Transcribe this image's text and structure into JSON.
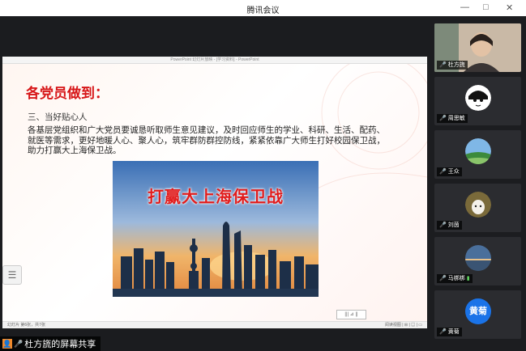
{
  "window": {
    "title": "腾讯会议",
    "controls": [
      "—",
      "□",
      "✕"
    ]
  },
  "presentation": {
    "app_title": "PowerPoint 幻灯片放映 - [学习资料] - PowerPoint",
    "heading": "各党员做到：",
    "subheading": "三、当好贴心人",
    "body": "各基层党组织和广大党员要诚恳听取师生意见建议，及时回应师生的学业、科研、生活、配药、就医等需求，更好地暖人心、聚人心，筑牢群防群控防线，紧紧依靠广大师生打好校园保卫战，助力打赢大上海保卫战。",
    "banner_text": "打赢大上海保卫战",
    "status_left": "幻灯片 第6张，共7张",
    "status_right": "阅读视图 | ⊞ | ▤ | ▭",
    "thumb_label": "|||  ⊿  ||"
  },
  "share": {
    "label": "杜方旒的屏幕共享"
  },
  "participants": [
    {
      "name": "杜方旒",
      "type": "video",
      "colors": [
        "#b48a6a",
        "#ddd"
      ]
    },
    {
      "name": "周思敏",
      "type": "avatar-cartoon"
    },
    {
      "name": "王众",
      "type": "avatar-landscape"
    },
    {
      "name": "刘茵",
      "type": "avatar-dog"
    },
    {
      "name": "马梆梆",
      "type": "avatar-sea"
    },
    {
      "name": "黄菊",
      "type": "text-avatar",
      "avatar_text": "黄菊"
    }
  ],
  "colors": {
    "heading_red": "#d71618",
    "accent_orange": "#f08a2c",
    "avatar_blue": "#1a73e8"
  }
}
